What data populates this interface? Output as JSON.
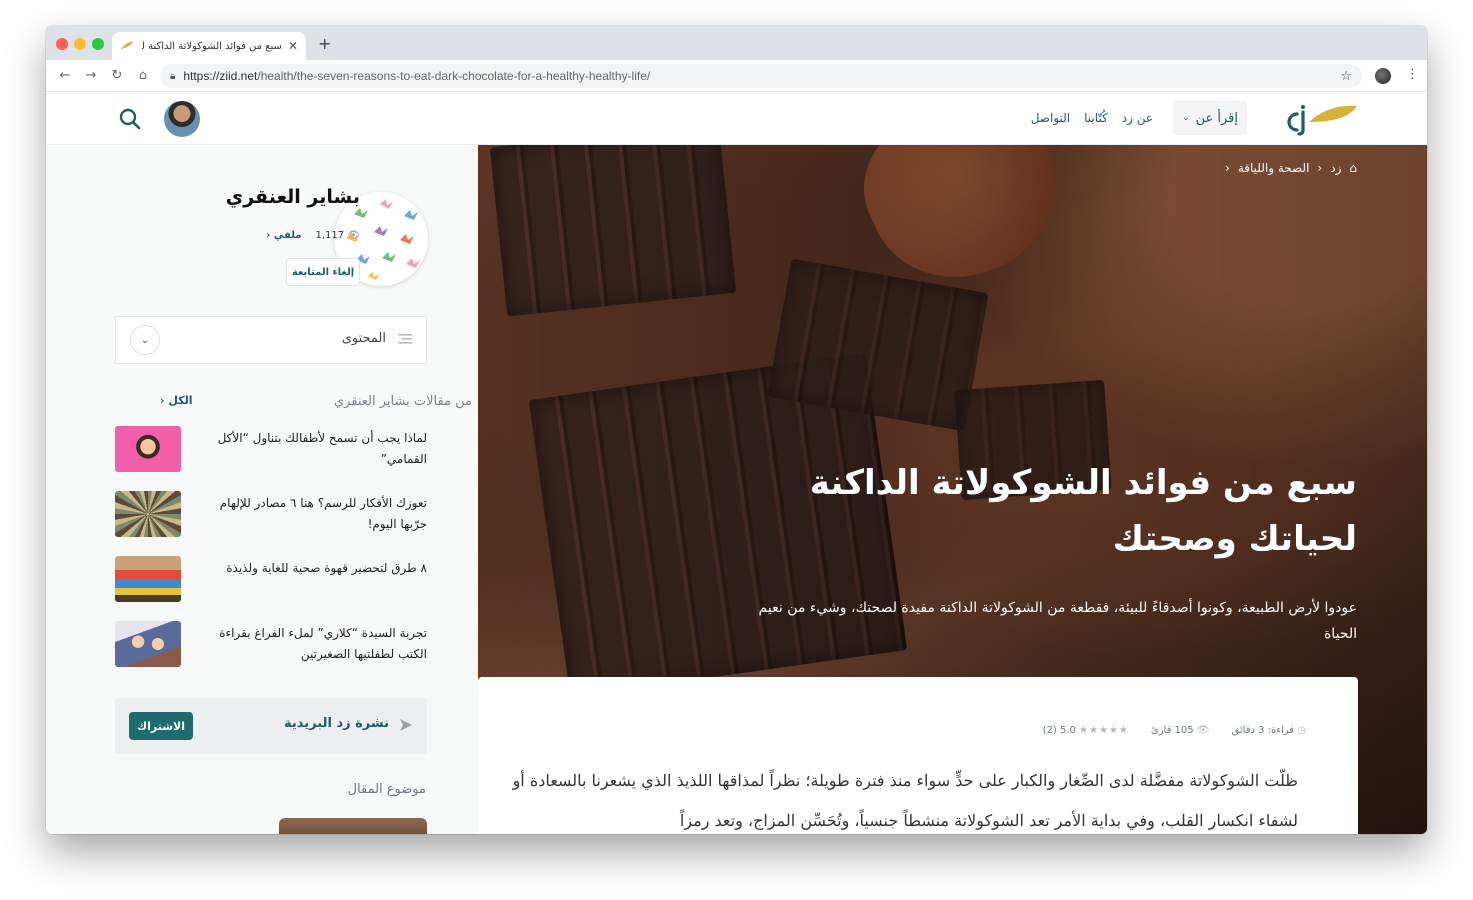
{
  "browser": {
    "tab_title": "سبع من فوائد الشوكولاتة الداكنة لحياتك وصحتك",
    "new_tab": "+",
    "url_host": "https://ziid.net",
    "url_path": "/health/the-seven-reasons-to-eat-dark-chocolate-for-a-healthy-healthy-life/"
  },
  "header": {
    "read_about": "إقرأ عن",
    "nav": [
      "عن زد",
      "كُتّابنا",
      "التواصل"
    ]
  },
  "breadcrumb": {
    "home": "زد",
    "category": "الصحة واللياقة"
  },
  "hero": {
    "title": "سبع من فوائد الشوكولاتة الداكنة لحياتك وصحتك",
    "subtitle": "عودوا لأرض الطبيعة، وكونوا أصدقاءً للبيئة، فقطعة من الشوكولاتة الداكنة مفيدة لصحتك، وشيء من نعيم الحياة"
  },
  "article": {
    "reading_time": "قراءة: 3 دقائق",
    "readers": "105 قارئ",
    "rating": "5.0",
    "rating_count": "(2)",
    "rating_value": 5,
    "body": "ظلّت الشوكولاتة مفضَّلة لدى الصِّغار والكبار على حدٍّ سواء منذ فترة طويلة؛ نظراً لمذاقها اللذيذ الذي يشعرنا بالسعادة أو لشفاء انكسار القلب، وفي بداية الأمر تعد الشوكولاتة منشطاً جنسياً، وتُحَسِّن المزاج، وتعد رمزاً"
  },
  "author": {
    "name": "بشاير العنقري",
    "views": "1,117",
    "profile_link": "ملفي",
    "unfollow": "إلغاء المتابعة"
  },
  "toc": {
    "label": "المحتوى"
  },
  "more": {
    "title": "من مقالات بشاير العنقري",
    "all": "الكل",
    "items": [
      {
        "title": "لماذا يجب أن تسمح لأطفالك بتناول “الأكل القمامي”"
      },
      {
        "title": "تعوزك الأفكار للرسم؟ هنا ٦ مصادر للإلهام جرّبها اليوم!"
      },
      {
        "title": "٨ طرق لتحضير قهوة صحية للغاية ولذيذة"
      },
      {
        "title": "تجربة السيدة “كلاري” لملء الفراغ بقراءة الكتب لطفلتيها الصغيرتين"
      }
    ]
  },
  "newsletter": {
    "label": "نشرة زد البريدية",
    "subscribe": "الاشتراك"
  },
  "topic": {
    "label": "موضوع المقال"
  },
  "colors": {
    "brand": "#1e5c6b",
    "accent": "#d4b13a",
    "button": "#1e6b70"
  }
}
